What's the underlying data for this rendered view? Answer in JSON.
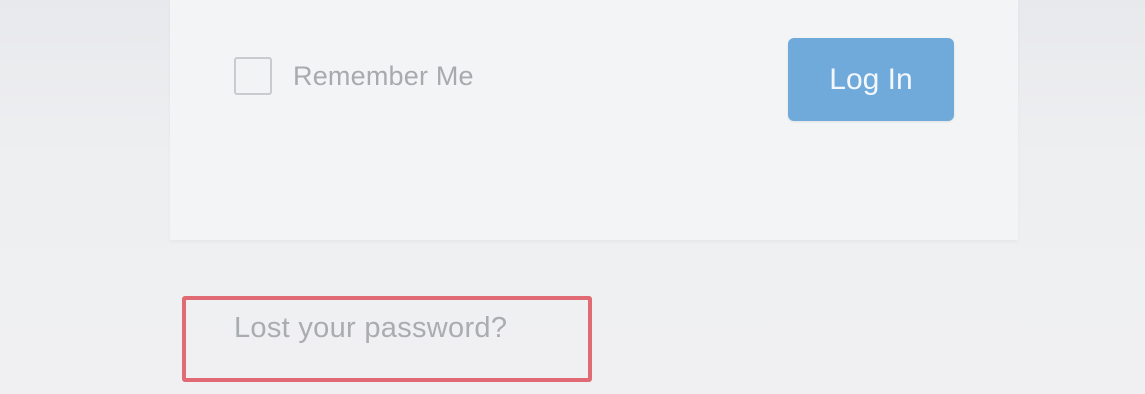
{
  "login_form": {
    "remember_me_label": "Remember Me",
    "remember_me_checked": false,
    "login_button_label": "Log In"
  },
  "lost_password": {
    "link_text": "Lost your password?"
  },
  "colors": {
    "button": "#6faadb",
    "highlight_border": "#e06b74"
  }
}
